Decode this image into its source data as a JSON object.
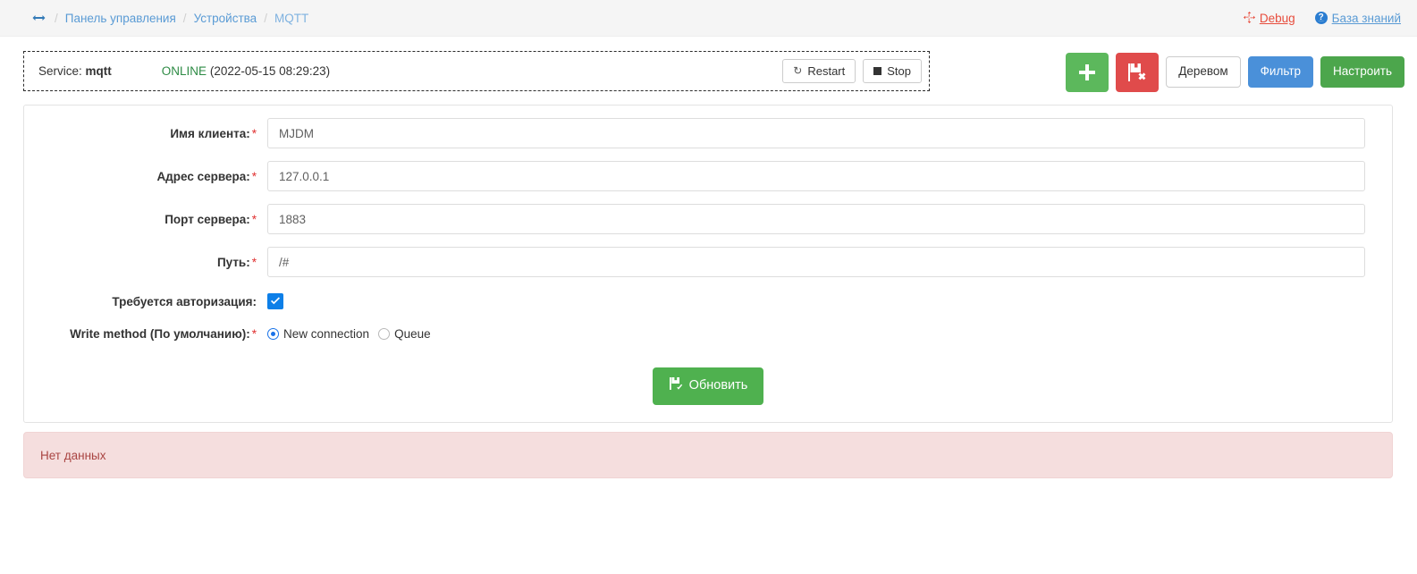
{
  "topbar": {
    "home_icon": "arrows-left-right-icon",
    "separator": "/",
    "breadcrumbs": [
      {
        "label": "Панель управления"
      },
      {
        "label": "Устройства"
      },
      {
        "label": "MQTT"
      }
    ],
    "right_links": [
      {
        "label": "Debug",
        "icon": "arrows-alt-icon",
        "color": "#e74c3c"
      },
      {
        "label": "База знаний",
        "icon": "question-circle-icon",
        "color": "#5a9bd5"
      }
    ]
  },
  "service": {
    "label": "Service:",
    "name": "mqtt",
    "status": "ONLINE",
    "status_color": "#2e8b45",
    "status_time": "(2022-05-15 08:29:23)",
    "restart_label": "Restart",
    "stop_label": "Stop"
  },
  "actions": {
    "add_label": "",
    "add_icon": "plus-icon",
    "delete_icon": "save-delete-icon",
    "tree_label": "Деревом",
    "filter_label": "Фильтр",
    "configure_label": "Настроить"
  },
  "form": {
    "fields": [
      {
        "label": "Имя клиента:",
        "required": "*",
        "value": "MJDM",
        "placeholder": ""
      },
      {
        "label": "Адрес сервера:",
        "required": "*",
        "value": "127.0.0.1",
        "placeholder": ""
      },
      {
        "label": "Порт сервера:",
        "required": "*",
        "value": "1883",
        "placeholder": ""
      },
      {
        "label": "Путь:",
        "required": "*",
        "value": "/#",
        "placeholder": ""
      }
    ],
    "auth": {
      "label": "Требуется авторизация:",
      "checked": true
    },
    "write_method": {
      "label": "Write method (По умолчанию):",
      "required": "*",
      "options": [
        {
          "label": "New connection",
          "selected": true
        },
        {
          "label": "Queue",
          "selected": false
        }
      ]
    },
    "submit_label": "Обновить",
    "submit_icon": "save-check-icon"
  },
  "alert": {
    "message": "Нет данных",
    "bg": "#f5dede",
    "fg": "#a94442"
  }
}
